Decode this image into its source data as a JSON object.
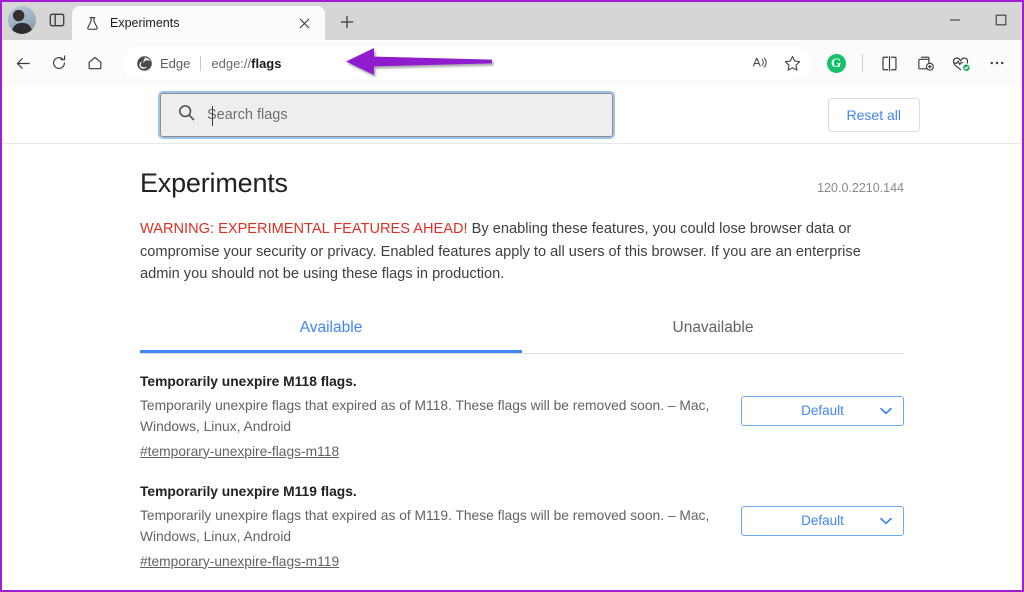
{
  "window": {
    "minimize_label": "Minimize",
    "maximize_label": "Maximize",
    "avatar_label": "Profile"
  },
  "tabstrip": {
    "tab_actions_label": "Tab actions menu",
    "tabs": [
      {
        "title": "Experiments",
        "favicon": "flask-icon",
        "close_label": "Close tab"
      }
    ],
    "new_tab_label": "New tab"
  },
  "toolbar": {
    "back_label": "Back",
    "refresh_label": "Refresh",
    "home_label": "Home",
    "omnibox": {
      "brand": "Edge",
      "url_prefix": "edge://",
      "url_page": "flags",
      "read_aloud_label": "Read aloud",
      "favorite_label": "Add this page to favorites"
    },
    "extensions": {
      "grammarly_letter": "G",
      "grammarly_label": "Grammarly",
      "split_screen_label": "Split screen",
      "collections_label": "Collections",
      "browser_essentials_label": "Browser essentials",
      "settings_label": "Settings and more"
    }
  },
  "flags_header": {
    "search_placeholder": "Search flags",
    "search_value": "",
    "search_icon": "search-icon",
    "reset_all_label": "Reset all"
  },
  "main": {
    "title": "Experiments",
    "version": "120.0.2210.144",
    "warning_highlight": "WARNING: EXPERIMENTAL FEATURES AHEAD!",
    "warning_body": " By enabling these features, you could lose browser data or compromise your security or privacy. Enabled features apply to all users of this browser. If you are an enterprise admin you should not be using these flags in production.",
    "tabs": [
      {
        "label": "Available",
        "active": true
      },
      {
        "label": "Unavailable",
        "active": false
      }
    ],
    "flags": [
      {
        "name": "Temporarily unexpire M118 flags.",
        "description": "Temporarily unexpire flags that expired as of M118. These flags will be removed soon. – Mac, Windows, Linux, Android",
        "link": "#temporary-unexpire-flags-m118",
        "select_value": "Default"
      },
      {
        "name": "Temporarily unexpire M119 flags.",
        "description": "Temporarily unexpire flags that expired as of M119. These flags will be removed soon. – Mac, Windows, Linux, Android",
        "link": "#temporary-unexpire-flags-m119",
        "select_value": "Default"
      }
    ]
  },
  "annotation": {
    "arrow_color": "#8f1fcf",
    "arrow_points_to": "address-bar"
  },
  "colors": {
    "accent_blue": "#4285f4",
    "warning_red": "#d93025",
    "frame_purple": "#a01fd4",
    "grammarly_green": "#15c26b"
  }
}
